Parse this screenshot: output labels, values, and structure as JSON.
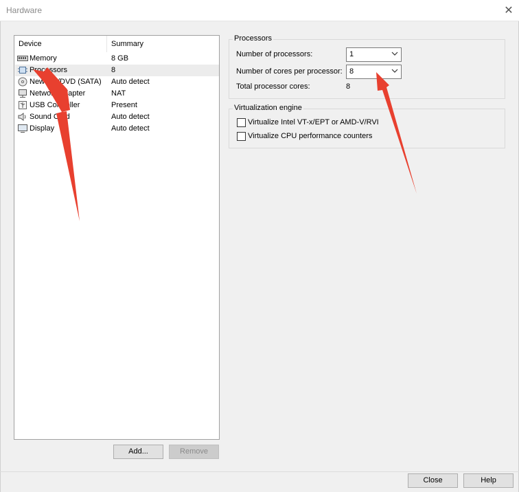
{
  "window": {
    "title": "Hardware",
    "close_glyph": "✕"
  },
  "device_list": {
    "columns": {
      "device": "Device",
      "summary": "Summary"
    },
    "rows": [
      {
        "name": "Memory",
        "summary": "8 GB",
        "icon": "memory-icon"
      },
      {
        "name": "Processors",
        "summary": "8",
        "icon": "processor-icon"
      },
      {
        "name": "New CD/DVD (SATA)",
        "summary": "Auto detect",
        "icon": "cd-dvd-icon"
      },
      {
        "name": "Network Adapter",
        "summary": "NAT",
        "icon": "network-icon"
      },
      {
        "name": "USB Controller",
        "summary": "Present",
        "icon": "usb-icon"
      },
      {
        "name": "Sound Card",
        "summary": "Auto detect",
        "icon": "sound-icon"
      },
      {
        "name": "Display",
        "summary": "Auto detect",
        "icon": "display-icon"
      }
    ],
    "selected_index": 1,
    "add_label": "Add...",
    "remove_label": "Remove"
  },
  "processors": {
    "group_label": "Processors",
    "num_processors_label": "Number of processors:",
    "num_processors_value": "1",
    "cores_label": "Number of cores per processor:",
    "cores_value": "8",
    "total_label": "Total processor cores:",
    "total_value": "8"
  },
  "virtualization": {
    "group_label": "Virtualization engine",
    "vtx_label": "Virtualize Intel VT-x/EPT or AMD-V/RVI",
    "vtx_checked": false,
    "perf_label": "Virtualize CPU performance counters",
    "perf_checked": false
  },
  "footer": {
    "close_label": "Close",
    "help_label": "Help"
  },
  "annotation_color": "#e8402f"
}
